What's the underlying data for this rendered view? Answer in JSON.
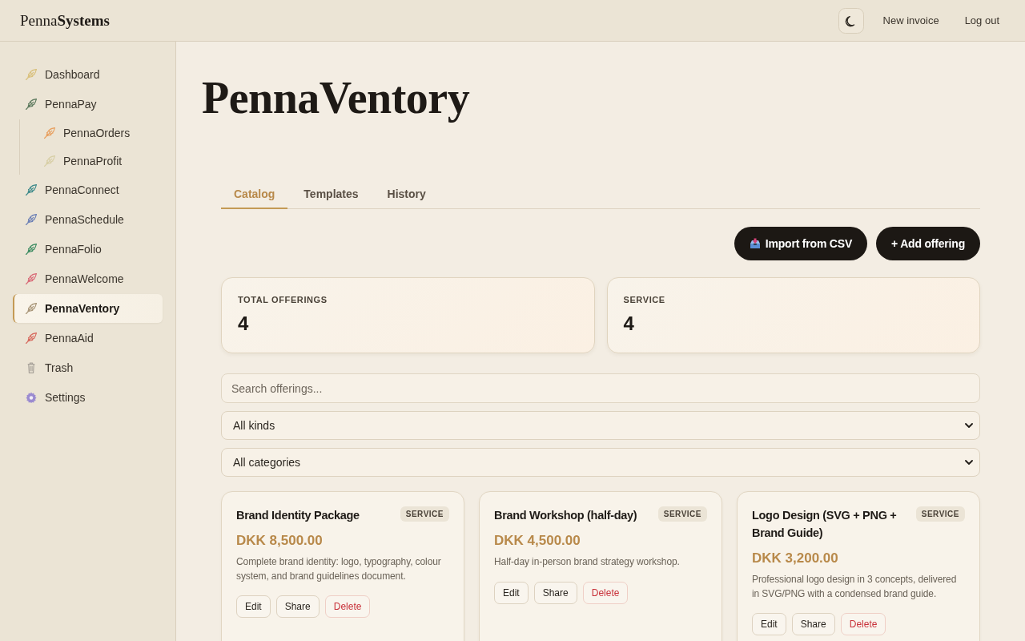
{
  "header": {
    "logo": "Penna**Systems**",
    "links": [
      "New invoice",
      "Log out"
    ]
  },
  "sidebar": {
    "items": [
      {
        "label": "Dashboard",
        "kind": "feather",
        "color": "#d9c07c",
        "selected": false
      },
      {
        "label": "PennaPay",
        "kind": "feather",
        "color": "#5d7a5e",
        "selected": false,
        "children": [
          {
            "label": "PennaOrders",
            "kind": "feather",
            "color": "#e8a060",
            "selected": false
          },
          {
            "label": "PennaProfit",
            "kind": "feather",
            "color": "#d8cfa6",
            "selected": false
          }
        ]
      },
      {
        "label": "PennaConnect",
        "kind": "feather",
        "color": "#3f8b8b",
        "selected": false
      },
      {
        "label": "PennaSchedule",
        "kind": "feather",
        "color": "#6b7fb5",
        "selected": false
      },
      {
        "label": "PennaFolio",
        "kind": "feather",
        "color": "#3d8c62",
        "selected": false
      },
      {
        "label": "PennaWelcome",
        "kind": "feather",
        "color": "#d96b78",
        "selected": false
      },
      {
        "label": "PennaVentory",
        "kind": "feather",
        "color": "#a89578",
        "selected": true
      },
      {
        "label": "PennaAid",
        "kind": "feather",
        "color": "#d76a5e",
        "selected": false
      },
      {
        "label": "Trash",
        "kind": "trash",
        "color": "#a8a29a",
        "selected": false
      },
      {
        "label": "Settings",
        "kind": "gear",
        "color": "#9b8bd0",
        "selected": false
      }
    ]
  },
  "page": {
    "title": "PennaVentory"
  },
  "tabs": [
    {
      "label": "Catalog",
      "selected": true
    },
    {
      "label": "Templates",
      "selected": false
    },
    {
      "label": "History",
      "selected": false
    }
  ],
  "actions": [
    {
      "label": "Import from CSV",
      "kind": "import"
    },
    {
      "label": "+ Add offering",
      "kind": "add"
    }
  ],
  "stats": [
    {
      "label": "TOTAL OFFERINGS",
      "value": "4"
    },
    {
      "label": "SERVICE",
      "value": "4"
    }
  ],
  "filters": {
    "search": {
      "placeholder": "Search offerings..."
    },
    "selects": [
      {
        "value": "All kinds"
      },
      {
        "value": "All categories"
      }
    ]
  },
  "offerings": [
    {
      "title": "Brand Identity Package",
      "badge": "SERVICE",
      "price": "DKK 8,500.00",
      "description": "Complete brand identity: logo, typography, colour system, and brand guidelines document.",
      "buttons": [
        {
          "label": "Edit",
          "kind": "default"
        },
        {
          "label": "Share",
          "kind": "default"
        },
        {
          "label": "Delete",
          "kind": "danger"
        }
      ]
    },
    {
      "title": "Brand Workshop (half-day)",
      "badge": "SERVICE",
      "price": "DKK 4,500.00",
      "description": "Half-day in-person brand strategy workshop.",
      "buttons": [
        {
          "label": "Edit",
          "kind": "default"
        },
        {
          "label": "Share",
          "kind": "default"
        },
        {
          "label": "Delete",
          "kind": "danger"
        }
      ]
    },
    {
      "title": "Logo Design (SVG + PNG + Brand Guide)",
      "badge": "SERVICE",
      "price": "DKK 3,200.00",
      "description": "Professional logo design in 3 concepts, delivered in SVG/PNG with a condensed brand guide.",
      "buttons": [
        {
          "label": "Edit",
          "kind": "default"
        },
        {
          "label": "Share",
          "kind": "default"
        },
        {
          "label": "Delete",
          "kind": "danger"
        }
      ]
    }
  ]
}
